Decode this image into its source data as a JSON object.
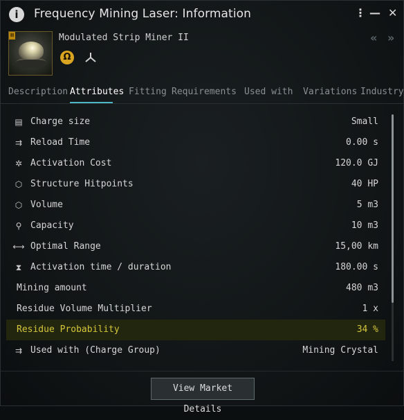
{
  "window": {
    "title": "Frequency Mining Laser: Information",
    "menu_icon": "kebab-menu-icon",
    "minimize_icon": "minimize-icon",
    "close_icon": "close-icon"
  },
  "item": {
    "name": "Modulated Strip Miner II",
    "tech_badge": "II",
    "omega_symbol": "Ω",
    "prev_icon": "«",
    "next_icon": "»"
  },
  "tabs": [
    {
      "label": "Description",
      "active": false
    },
    {
      "label": "Attributes",
      "active": true
    },
    {
      "label": "Fitting",
      "active": false
    },
    {
      "label": "Requirements",
      "active": false
    },
    {
      "label": "Used with",
      "active": false
    },
    {
      "label": "Variations",
      "active": false
    },
    {
      "label": "Industry",
      "active": false
    }
  ],
  "attributes": [
    {
      "icon": "charge-size-icon",
      "label": "Charge size",
      "value": "Small"
    },
    {
      "icon": "reload-time-icon",
      "label": "Reload Time",
      "value": "0.00 s"
    },
    {
      "icon": "activation-cost-icon",
      "label": "Activation Cost",
      "value": "120.0 GJ"
    },
    {
      "icon": "structure-hitpoints-icon",
      "label": "Structure Hitpoints",
      "value": "40 HP"
    },
    {
      "icon": "volume-icon",
      "label": "Volume",
      "value": "5 m3"
    },
    {
      "icon": "capacity-icon",
      "label": "Capacity",
      "value": "10 m3"
    },
    {
      "icon": "optimal-range-icon",
      "label": "Optimal Range",
      "value": "15,00 km"
    },
    {
      "icon": "hourglass-icon",
      "label": "Activation time / duration",
      "value": "180.00 s"
    },
    {
      "icon": "",
      "label": "Mining amount",
      "value": "480 m3"
    },
    {
      "icon": "",
      "label": "Residue Volume Multiplier",
      "value": "1 x"
    },
    {
      "icon": "",
      "label": "Residue Probability",
      "value": "34 %",
      "highlighted": true
    },
    {
      "icon": "used-with-icon",
      "label": "Used with (Charge Group)",
      "value": "Mining Crystal"
    }
  ],
  "footer": {
    "market_button": "View Market Details"
  },
  "colors": {
    "highlight_text": "#d4c63a",
    "highlight_bg": "#23260f",
    "tab_accent": "#4fb6c7",
    "omega_badge": "#d9a521"
  }
}
